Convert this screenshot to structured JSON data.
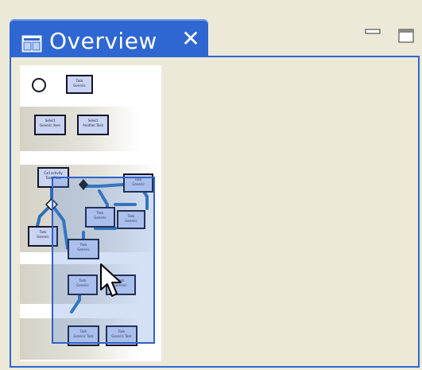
{
  "tab": {
    "label": "Overview",
    "icon": "overview-icon",
    "close_label": "✕"
  },
  "window_controls": {
    "minimize_icon": "minimize-icon",
    "maximize_icon": "maximize-icon"
  },
  "colors": {
    "tab_active": "#2f67d2",
    "panel_bg": "#ece9d8",
    "viewport": "#2e62c8"
  },
  "diagram": {
    "nodes": [
      {
        "title": "Task",
        "subtitle": "Generic"
      },
      {
        "title": "Select",
        "subtitle": "Generic item"
      },
      {
        "title": "Select",
        "subtitle": "Another Task"
      },
      {
        "title": "Call activity",
        "subtitle": "Task Flow"
      },
      {
        "title": "Task",
        "subtitle": "Generic"
      },
      {
        "title": "Task",
        "subtitle": "Generic"
      },
      {
        "title": "Task",
        "subtitle": "Generic"
      },
      {
        "title": "Task",
        "subtitle": "Generic"
      },
      {
        "title": "Task",
        "subtitle": "Generic"
      },
      {
        "title": "Task",
        "subtitle": "Generic"
      },
      {
        "title": "Task",
        "subtitle": "Generic"
      },
      {
        "title": "Task",
        "subtitle": "Generic Task"
      },
      {
        "title": "Task",
        "subtitle": "Generic Task"
      }
    ]
  }
}
